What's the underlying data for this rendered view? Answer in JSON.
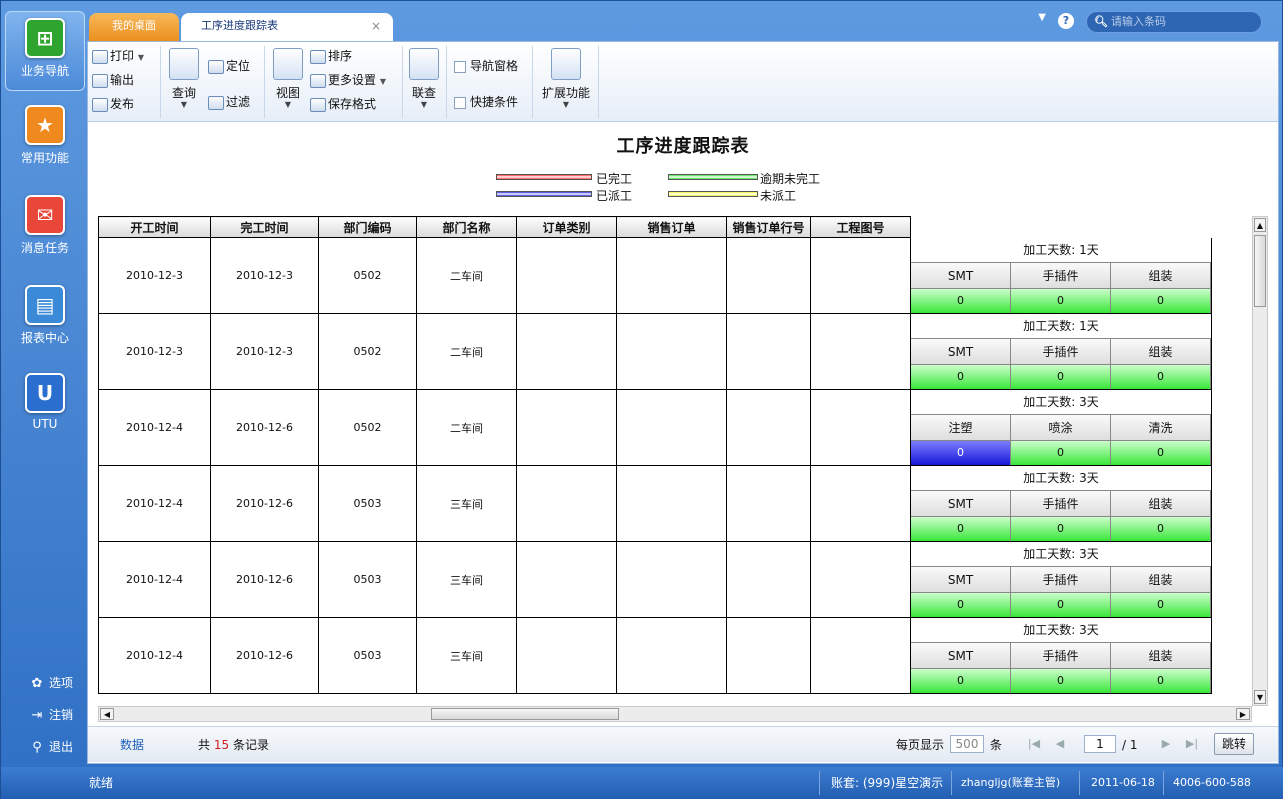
{
  "leftnav": {
    "items": [
      {
        "label": "业务导航",
        "icon": "business-nav-icon",
        "color": "#2fa52f"
      },
      {
        "label": "常用功能",
        "icon": "star-icon",
        "color": "#f08a1e"
      },
      {
        "label": "消息任务",
        "icon": "message-task-icon",
        "color": "#e8473a"
      },
      {
        "label": "报表中心",
        "icon": "report-icon",
        "color": "#3a8ad8"
      },
      {
        "label": "UTU",
        "icon": "utu-icon",
        "color": "#2a6fd0"
      }
    ],
    "bottom": [
      {
        "label": "选项",
        "icon": "gear-icon"
      },
      {
        "label": "注销",
        "icon": "logout-icon"
      },
      {
        "label": "退出",
        "icon": "key-icon"
      }
    ]
  },
  "tabs": {
    "home": "我的桌面",
    "current": "工序进度跟踪表",
    "close_glyph": "×"
  },
  "search": {
    "placeholder": "请输入条码",
    "icon": "search-icon"
  },
  "toolbar": {
    "print": "打印",
    "export": "输出",
    "publish": "发布",
    "query": "查询",
    "locate": "定位",
    "filter": "过滤",
    "view": "视图",
    "sort": "排序",
    "more_settings": "更多设置",
    "save_format": "保存格式",
    "link_query": "联查",
    "nav_pane": "导航窗格",
    "quick_cond": "快捷条件",
    "extend": "扩展功能"
  },
  "report": {
    "title": "工序进度跟踪表",
    "legend": [
      {
        "label": "已完工",
        "color": "#ff3b3b"
      },
      {
        "label": "已派工",
        "color": "#2a2ae0"
      },
      {
        "label": "逾期未完工",
        "color": "#3ee03e"
      },
      {
        "label": "未派工",
        "color": "#f5f53c"
      }
    ],
    "columns": [
      "开工时间",
      "完工时间",
      "部门编码",
      "部门名称",
      "订单类别",
      "销售订单",
      "销售订单行号",
      "工程图号"
    ],
    "rows": [
      {
        "start": "2010-12-3",
        "end": "2010-12-3",
        "dept_code": "0502",
        "dept_name": "二车间",
        "days": "加工天数: 1天",
        "procs": [
          "SMT",
          "手插件",
          "组装"
        ],
        "vals": [
          "0",
          "0",
          "0"
        ],
        "blue_first": false
      },
      {
        "start": "2010-12-3",
        "end": "2010-12-3",
        "dept_code": "0502",
        "dept_name": "二车间",
        "days": "加工天数: 1天",
        "procs": [
          "SMT",
          "手插件",
          "组装"
        ],
        "vals": [
          "0",
          "0",
          "0"
        ],
        "blue_first": false
      },
      {
        "start": "2010-12-4",
        "end": "2010-12-6",
        "dept_code": "0502",
        "dept_name": "二车间",
        "days": "加工天数: 3天",
        "procs": [
          "注塑",
          "喷涂",
          "清洗"
        ],
        "vals": [
          "0",
          "0",
          "0"
        ],
        "blue_first": true
      },
      {
        "start": "2010-12-4",
        "end": "2010-12-6",
        "dept_code": "0503",
        "dept_name": "三车间",
        "days": "加工天数: 3天",
        "procs": [
          "SMT",
          "手插件",
          "组装"
        ],
        "vals": [
          "0",
          "0",
          "0"
        ],
        "blue_first": false
      },
      {
        "start": "2010-12-4",
        "end": "2010-12-6",
        "dept_code": "0503",
        "dept_name": "三车间",
        "days": "加工天数: 3天",
        "procs": [
          "SMT",
          "手插件",
          "组装"
        ],
        "vals": [
          "0",
          "0",
          "0"
        ],
        "blue_first": false
      },
      {
        "start": "2010-12-4",
        "end": "2010-12-6",
        "dept_code": "0503",
        "dept_name": "三车间",
        "days": "加工天数: 3天",
        "procs": [
          "SMT",
          "手插件",
          "组装"
        ],
        "vals": [
          "0",
          "0",
          "0"
        ],
        "blue_first": false
      }
    ]
  },
  "pager": {
    "data_link": "数据",
    "total_prefix": "共",
    "total_count": "15",
    "total_suffix": "条记录",
    "per_page_label": "每页显示",
    "per_page": "500",
    "per_page_unit": "条",
    "current_page": "1",
    "total_pages": "/ 1",
    "jump": "跳转"
  },
  "status": {
    "ready": "就绪",
    "account": "账套: (999)星空演示",
    "user": "zhangljg(账套主管)",
    "date": "2011-06-18",
    "phone": "4006-600-588"
  }
}
